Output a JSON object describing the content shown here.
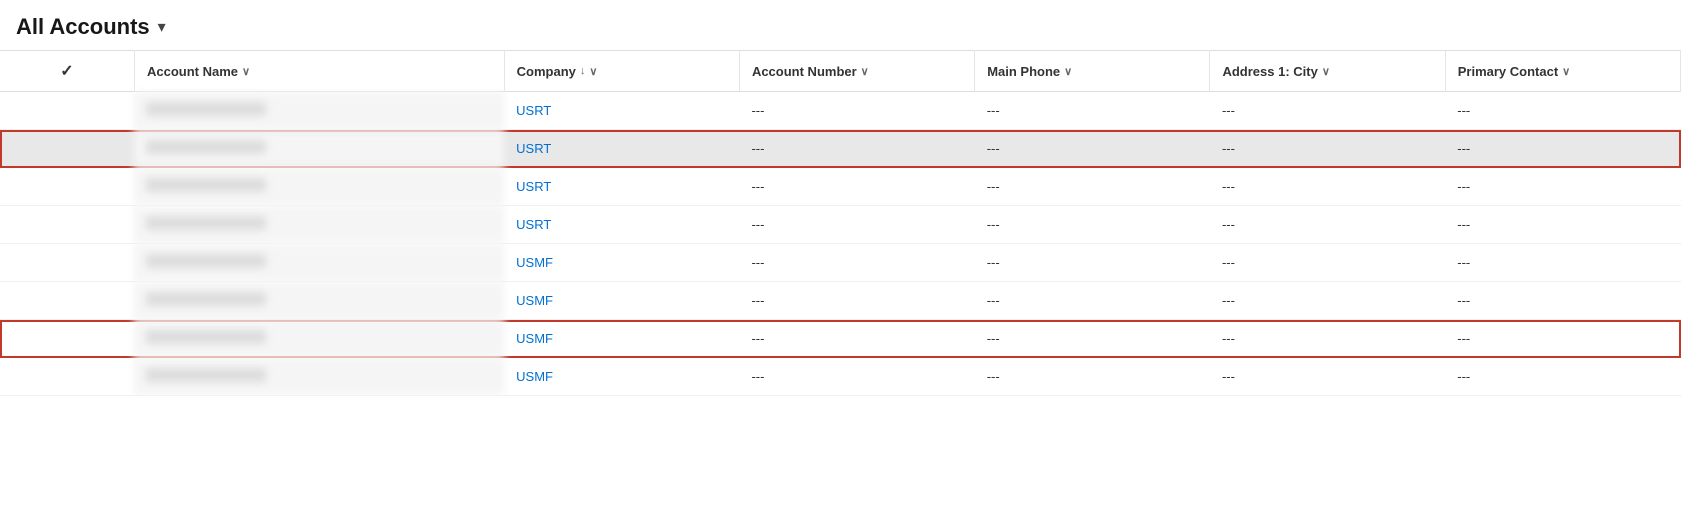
{
  "header": {
    "title": "All Accounts",
    "chevron": "▾"
  },
  "columns": [
    {
      "id": "check",
      "label": "",
      "sortable": false
    },
    {
      "id": "account-name",
      "label": "Account Name",
      "sortable": true,
      "sort_dir": null
    },
    {
      "id": "company",
      "label": "Company",
      "sortable": true,
      "sort_dir": "desc"
    },
    {
      "id": "account-number",
      "label": "Account Number",
      "sortable": true,
      "sort_dir": null
    },
    {
      "id": "main-phone",
      "label": "Main Phone",
      "sortable": true,
      "sort_dir": null
    },
    {
      "id": "address-city",
      "label": "Address 1: City",
      "sortable": true,
      "sort_dir": null
    },
    {
      "id": "primary-contact",
      "label": "Primary Contact",
      "sortable": true,
      "sort_dir": null
    }
  ],
  "rows": [
    {
      "id": "row1",
      "check": "",
      "account_name_blurred": true,
      "account_name": "",
      "company": "USRT",
      "account_number": "---",
      "main_phone": "---",
      "address_city": "---",
      "primary_contact": "---",
      "selected": false,
      "highlighted": false
    },
    {
      "id": "row2",
      "check": "",
      "account_name_blurred": true,
      "account_name": "",
      "company": "USRT",
      "account_number": "---",
      "main_phone": "---",
      "address_city": "---",
      "primary_contact": "---",
      "selected": true,
      "highlighted": false
    },
    {
      "id": "row3",
      "check": "",
      "account_name_blurred": true,
      "account_name": "",
      "company": "USRT",
      "account_number": "---",
      "main_phone": "---",
      "address_city": "---",
      "primary_contact": "---",
      "selected": false,
      "highlighted": false
    },
    {
      "id": "row4",
      "check": "",
      "account_name_blurred": true,
      "account_name": "",
      "company": "USRT",
      "account_number": "---",
      "main_phone": "---",
      "address_city": "---",
      "primary_contact": "---",
      "selected": false,
      "highlighted": false
    },
    {
      "id": "row5",
      "check": "",
      "account_name_blurred": true,
      "account_name": "",
      "company": "USMF",
      "account_number": "---",
      "main_phone": "---",
      "address_city": "---",
      "primary_contact": "---",
      "selected": false,
      "highlighted": false
    },
    {
      "id": "row6",
      "check": "",
      "account_name_blurred": true,
      "account_name": "",
      "company": "USMF",
      "account_number": "---",
      "main_phone": "---",
      "address_city": "---",
      "primary_contact": "---",
      "selected": false,
      "highlighted": false
    },
    {
      "id": "row7",
      "check": "",
      "account_name_blurred": true,
      "account_name": "",
      "company": "USMF",
      "account_number": "---",
      "main_phone": "---",
      "address_city": "---",
      "primary_contact": "---",
      "selected": false,
      "highlighted": true
    },
    {
      "id": "row8",
      "check": "",
      "account_name_blurred": true,
      "account_name": "",
      "company": "USMF",
      "account_number": "---",
      "main_phone": "---",
      "address_city": "---",
      "primary_contact": "---",
      "selected": false,
      "highlighted": false
    }
  ],
  "empty_cell": "---",
  "chevron_down": "∨",
  "sort_down": "↓"
}
